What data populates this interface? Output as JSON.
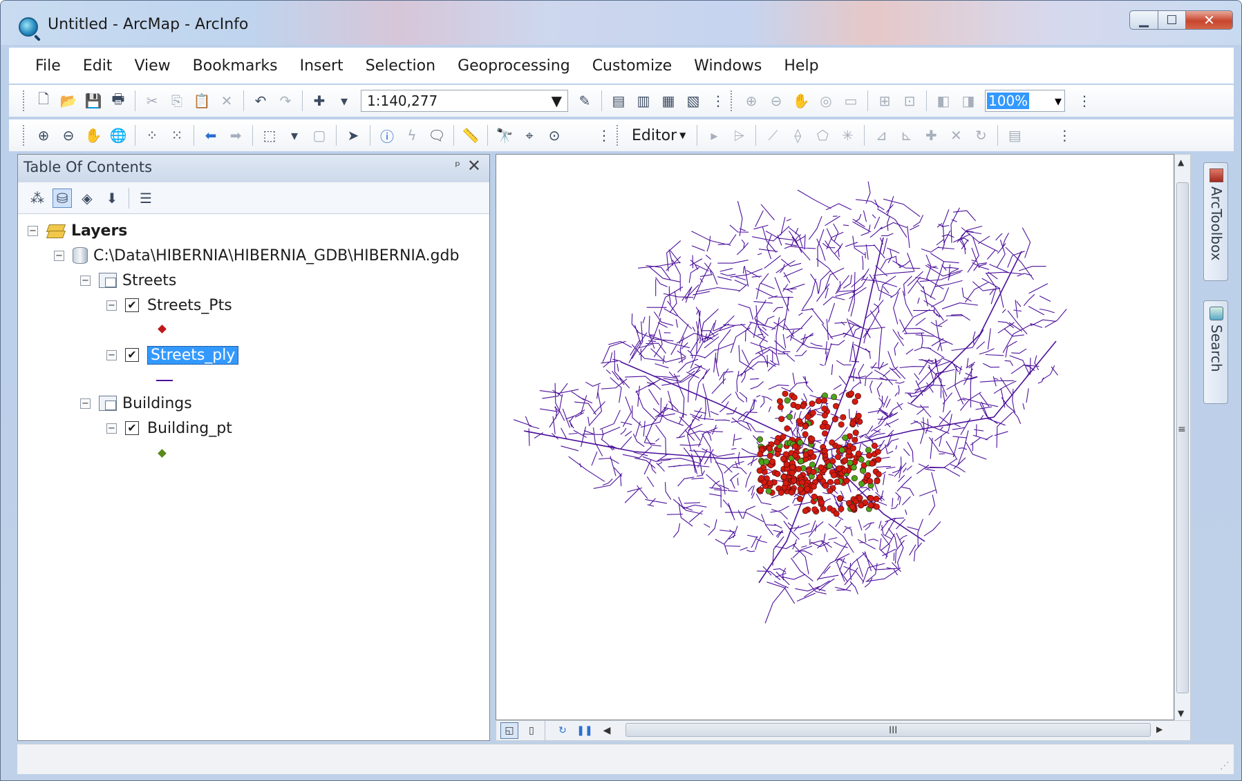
{
  "window": {
    "title": "Untitled - ArcMap - ArcInfo",
    "controls": {
      "minimize": "▁",
      "maximize": "☐",
      "close": "✕"
    }
  },
  "menu": [
    "File",
    "Edit",
    "View",
    "Bookmarks",
    "Insert",
    "Selection",
    "Geoprocessing",
    "Customize",
    "Windows",
    "Help"
  ],
  "toolbar": {
    "scale": "1:140,277",
    "zoom": "100%",
    "editor": "Editor"
  },
  "toc": {
    "title": "Table Of Contents",
    "pin": "ᵖ",
    "close": "✕",
    "layers_label": "Layers",
    "gdb_path": "C:\\Data\\HIBERNIA\\HIBERNIA_GDB\\HIBERNIA.gdb",
    "groups": [
      {
        "name": "Streets",
        "layers": [
          {
            "name": "Streets_Pts",
            "checked": true,
            "symbol": "point",
            "color": "#c01818"
          },
          {
            "name": "Streets_ply",
            "checked": true,
            "symbol": "line",
            "color": "#4b0f9a",
            "selected": true
          }
        ]
      },
      {
        "name": "Buildings",
        "layers": [
          {
            "name": "Building_pt",
            "checked": true,
            "symbol": "point",
            "color": "#5a8a1a"
          }
        ]
      }
    ]
  },
  "dock": {
    "toolbox": "ArcToolbox",
    "search": "Search"
  },
  "map": {
    "street_color": "#4b0f9a",
    "point_red": "#d41a10",
    "point_green": "#4ea31c"
  },
  "scroll": {
    "grip": "III",
    "menu_grip": "≡"
  }
}
